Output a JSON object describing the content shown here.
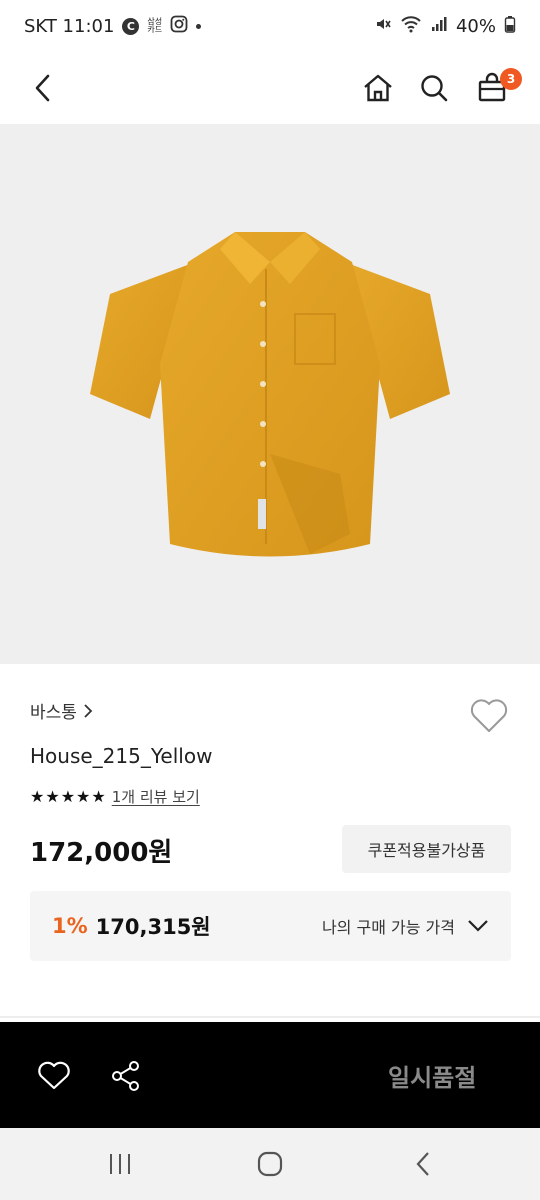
{
  "status_bar": {
    "carrier_time": "SKT 11:01",
    "c_icon": "C",
    "samsung_card_line1": "삼성",
    "samsung_card_line2": "카드",
    "battery": "40%"
  },
  "nav": {
    "cart_count": "3"
  },
  "product": {
    "brand": "바스통",
    "name": "House_215_Yellow",
    "rating_stars": 5,
    "review_link": "1개 리뷰 보기",
    "price": "172,000원",
    "coupon_button": "쿠폰적용불가상품",
    "discount_rate": "1%",
    "my_price": "170,315원",
    "my_price_label": "나의 구매 가능 가격",
    "image_color": "#e2a124"
  },
  "bottom_bar": {
    "soldout_label": "일시품절"
  },
  "colors": {
    "accent": "#e8641f",
    "badge": "#f05a22"
  }
}
